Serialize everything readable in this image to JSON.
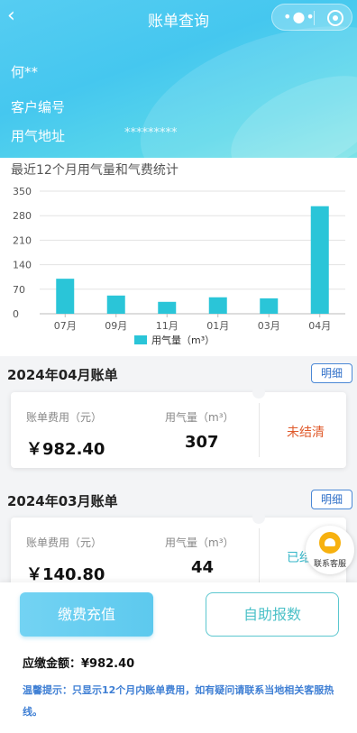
{
  "nav": {
    "title": "账单查询",
    "back_icon": "chevron-left-icon",
    "more_icon": "more-dots-icon",
    "close_icon": "target-close-icon"
  },
  "customer": {
    "name": "何**",
    "number_label": "客户编号",
    "address_label": "用气地址",
    "address_value": "*********"
  },
  "chart_section": {
    "title": "最近12个月用气量和气费统计"
  },
  "chart_data": {
    "type": "bar",
    "categories": [
      "07月",
      "09月",
      "11月",
      "01月",
      "03月",
      "04月"
    ],
    "series": [
      {
        "name": "用气量（m³）",
        "values": [
          100,
          52,
          34,
          47,
          44,
          307
        ]
      }
    ],
    "yticks": [
      0,
      70,
      140,
      210,
      280,
      350
    ],
    "ylim": [
      0,
      350
    ],
    "grid": true,
    "legend": "bottom",
    "color": "#2ac5d8"
  },
  "bills": [
    {
      "title": "2024年04月账单",
      "detail_label": "明细",
      "fee_label": "账单费用（元）",
      "fee_value": "￥982.40",
      "gas_label": "用气量（m³）",
      "gas_value": "307",
      "status": "未结清",
      "status_color": "#e05a2b"
    },
    {
      "title": "2024年03月账单",
      "detail_label": "明细",
      "fee_label": "账单费用（元）",
      "fee_value": "￥140.80",
      "gas_label": "用气量（m³）",
      "gas_value": "44",
      "status": "已结",
      "status_color": "#34b6c8"
    }
  ],
  "service": {
    "label": "联系客服",
    "icon": "customer-service-icon"
  },
  "bottom": {
    "pay_label": "缴费充值",
    "self_report_label": "自助报数",
    "due_text": "应缴金额：¥982.40",
    "tip_text": "温馨提示：只显示12个月内账单费用，如有疑问请联系当地相关客服热线。"
  },
  "colors": {
    "header": "#45c7ef",
    "accent": "#2ac5d8",
    "link": "#3f7fd4"
  }
}
